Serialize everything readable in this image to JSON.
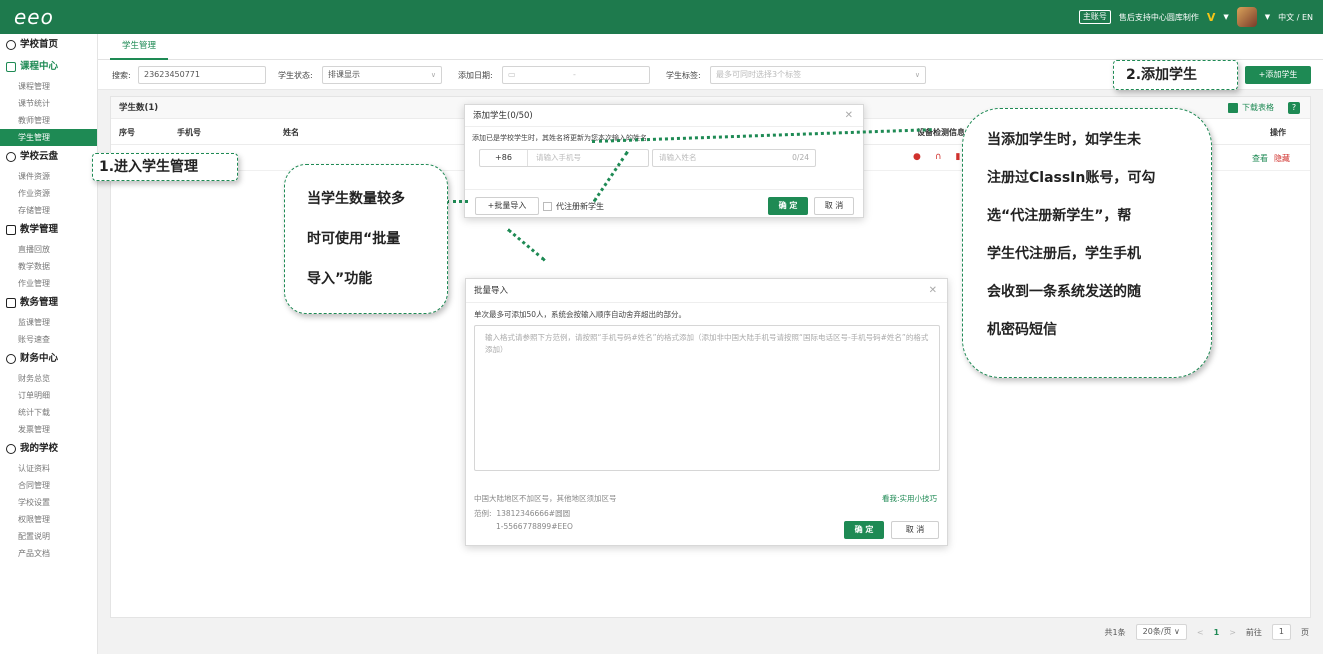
{
  "topbar": {
    "logo": "eeo",
    "account_badge": "主账号",
    "org_name": "售后支持中心圆库制作",
    "v_mark": "V",
    "lang": "中文 / EN"
  },
  "sidebar": {
    "sections": [
      {
        "label": "学校首页",
        "items": []
      },
      {
        "label": "课程中心",
        "items": [
          "课程管理",
          "课节统计",
          "教师管理",
          "学生管理"
        ]
      },
      {
        "label": "学校云盘",
        "items": [
          "课件资源",
          "作业资源",
          "存储管理"
        ]
      },
      {
        "label": "教学管理",
        "items": [
          "直播回放",
          "教学数据",
          "作业管理"
        ]
      },
      {
        "label": "教务管理",
        "items": [
          "监课管理",
          "账号速查"
        ]
      },
      {
        "label": "财务中心",
        "items": [
          "财务总览",
          "订单明细",
          "统计下载",
          "发票管理"
        ]
      },
      {
        "label": "我的学校",
        "items": [
          "认证资料",
          "合同管理",
          "学校设置",
          "权限管理",
          "配置说明",
          "产品文档"
        ]
      }
    ]
  },
  "main": {
    "tab": "学生管理",
    "filters": {
      "search_label": "搜索:",
      "search_value": "23623450771",
      "status_label": "学生状态:",
      "status_value": "排课显示",
      "date_label": "添加日期:",
      "date_sep": "-",
      "tag_label": "学生标签:",
      "tag_placeholder": "最多可同时选择3个标签"
    },
    "add_button": "+添加学生",
    "panel_title": "学生数(1)",
    "export_label": "下载表格",
    "help": "?",
    "columns": [
      "序号",
      "手机号",
      "姓名",
      "设备检测信息",
      "操作"
    ],
    "row_ops": [
      "查看",
      "隐藏"
    ],
    "pager": {
      "total": "共1条",
      "page_size": "20条/页",
      "prev": "<",
      "current": "1",
      "next": ">",
      "goto": "前往",
      "goto_value": "1",
      "page_suffix": "页"
    }
  },
  "add_dialog": {
    "title": "添加学生(0/50)",
    "desc": "添加已是学校学生时，其姓名将更新为您本次输入的姓名",
    "country_code": "+86",
    "phone_placeholder": "请输入手机号",
    "name_placeholder": "请输入姓名",
    "name_count": "0/24",
    "batch_button": "+批量导入",
    "register_checkbox": "代注册新学生",
    "confirm": "确 定",
    "cancel": "取 消"
  },
  "batch_dialog": {
    "title": "批量导入",
    "desc": "单次最多可添加50人，系统会按输入顺序自动舍弃超出的部分。",
    "placeholder": "输入格式请参照下方范例，请按照“手机号码#姓名”的格式添加（添加非中国大陆手机号请按照“国际电话区号-手机号码#姓名”的格式添加）",
    "hint": "中国大陆地区不加区号，其他地区须加区号",
    "tip_link": "看我:实用小技巧",
    "example_label": "范例:",
    "example_1": "13812346666#圆圆",
    "example_2": "1-5566778899#EEO",
    "confirm": "确 定",
    "cancel": "取 消"
  },
  "callouts": {
    "step1": "1.进入学生管理",
    "step2": "2.添加学生",
    "batch_lines": [
      "当学生数量较多",
      "时可使用“批量",
      "导入”功能"
    ],
    "register_lines": [
      "当添加学生时，如学生未",
      "注册过ClassIn账号，可勾",
      "选“代注册新学生”，帮",
      "学生代注册后，学生手机",
      "会收到一条系统发送的随",
      "机密码短信"
    ]
  },
  "colors": {
    "brand_green": "#1e8a54",
    "topbar_green": "#1e7a4d",
    "alert_red": "#d0312d"
  }
}
